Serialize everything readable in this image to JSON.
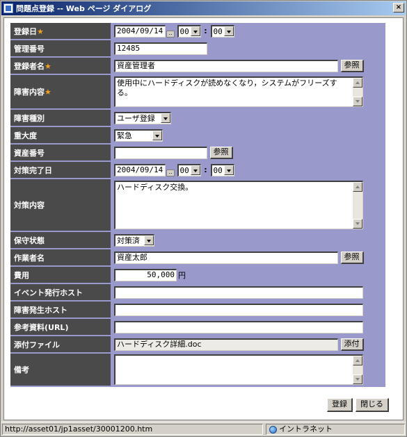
{
  "window": {
    "title": "問題点登録 -- Web ページ ダイアログ",
    "close": "×"
  },
  "fields": {
    "reg_date": {
      "label": "登録日",
      "date": "2004/09/14",
      "hour": "00",
      "minute": "00"
    },
    "mgmt_no": {
      "label": "管理番号",
      "value": "12485"
    },
    "registrant": {
      "label": "登録者名",
      "value": "資産管理者",
      "button": "参照"
    },
    "fault_desc": {
      "label": "障害内容",
      "value": "使用中にハードディスクが読めなくなり，システムがフリーズする。"
    },
    "fault_type": {
      "label": "障害種別",
      "value": "ユーザ登録"
    },
    "severity": {
      "label": "重大度",
      "value": "緊急"
    },
    "asset_no": {
      "label": "資産番号",
      "value": "",
      "button": "参照"
    },
    "fix_date": {
      "label": "対策完了日",
      "date": "2004/09/14",
      "hour": "00",
      "minute": "00"
    },
    "fix_desc": {
      "label": "対策内容",
      "value": "ハードディスク交換。"
    },
    "maint_status": {
      "label": "保守状態",
      "value": "対策済"
    },
    "worker": {
      "label": "作業者名",
      "value": "資産太郎",
      "button": "参照"
    },
    "cost": {
      "label": "費用",
      "value": "50,000",
      "unit": "円"
    },
    "event_host": {
      "label": "イベント発行ホスト",
      "value": ""
    },
    "fault_host": {
      "label": "障害発生ホスト",
      "value": ""
    },
    "reference": {
      "label": "参考資料(URL)",
      "value": ""
    },
    "attachment": {
      "label": "添付ファイル",
      "value": "ハードディスク詳細.doc",
      "button": "添付"
    },
    "remarks": {
      "label": "備考",
      "value": ""
    }
  },
  "required_mark": "★",
  "colon": ":",
  "cal_mark": "..",
  "buttons": {
    "register": "登録",
    "close": "閉じる"
  },
  "status": {
    "url": "http://asset01/jp1asset/30001200.htm",
    "zone": "イントラネット"
  }
}
